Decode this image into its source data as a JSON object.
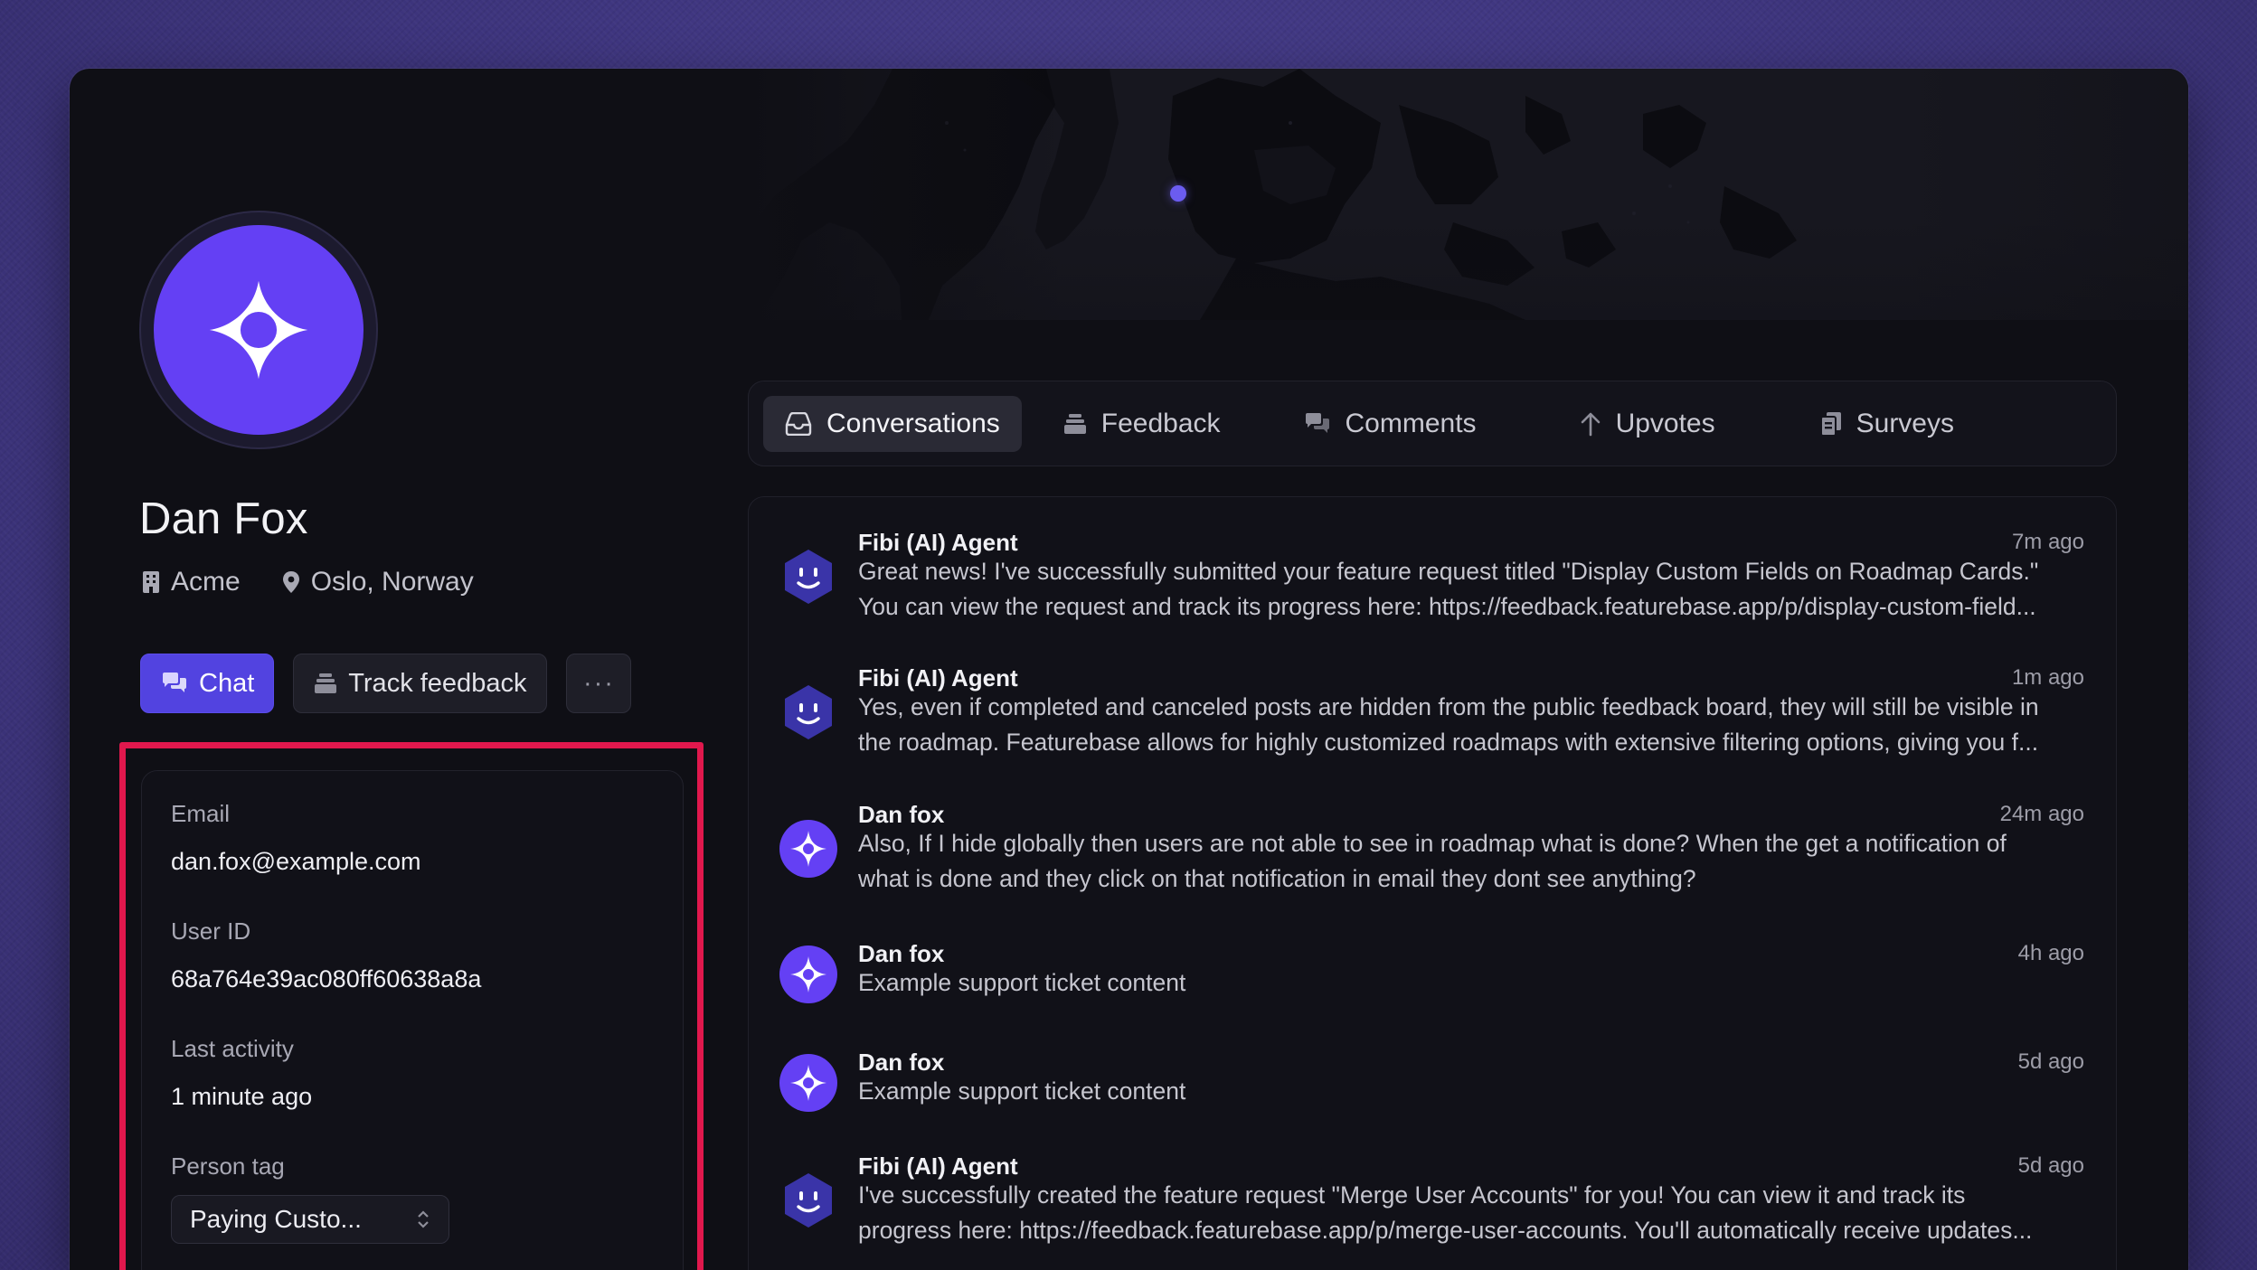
{
  "profile": {
    "name": "Dan Fox",
    "company": "Acme",
    "location": "Oslo, Norway",
    "avatar_color": "#6440f4"
  },
  "actions": {
    "chat_label": "Chat",
    "track_label": "Track feedback",
    "more_label": "···"
  },
  "details": {
    "email_label": "Email",
    "email_value": "dan.fox@example.com",
    "userid_label": "User ID",
    "userid_value": "68a764e39ac080ff60638a8a",
    "activity_label": "Last activity",
    "activity_value": "1 minute ago",
    "tag_label": "Person tag",
    "tag_value": "Paying Custo..."
  },
  "tabs": [
    {
      "label": "Conversations",
      "icon": "inbox-icon",
      "active": true
    },
    {
      "label": "Feedback",
      "icon": "stack-icon"
    },
    {
      "label": "Comments",
      "icon": "chat-bubbles-icon"
    },
    {
      "label": "Upvotes",
      "icon": "arrow-up-icon"
    },
    {
      "label": "Surveys",
      "icon": "clipboard-icon"
    }
  ],
  "conversations": [
    {
      "author": "Fibi (AI) Agent",
      "time": "7m ago",
      "line1": "Great news! I've successfully submitted your feature request titled \"Display Custom Fields on Roadmap Cards.\"",
      "line2": "You can view the request and track its progress here: https://feedback.featurebase.app/p/display-custom-field..."
    },
    {
      "author": "Fibi (AI) Agent",
      "time": "1m ago",
      "line1": "Yes, even if completed and canceled posts are hidden from the public feedback board, they will still be visible in",
      "line2": "the roadmap. Featurebase allows for highly customized roadmaps with extensive filtering options, giving you f..."
    },
    {
      "author": "Dan fox",
      "time": "24m ago",
      "line1": "Also, If I hide globally then users are not able to see in roadmap what is done? When the get a notification of",
      "line2": "what is done and they click on that notification in email they dont see anything?"
    },
    {
      "author": "Dan fox",
      "time": "4h ago",
      "line1": "Example support ticket content"
    },
    {
      "author": "Dan fox",
      "time": "5d ago",
      "line1": "Example support ticket content"
    },
    {
      "author": "Fibi (AI) Agent",
      "time": "5d ago",
      "line1": "I've successfully created the feature request \"Merge User Accounts\" for you! You can view it and track its",
      "line2": "progress here: https://feedback.featurebase.app/p/merge-user-accounts. You'll automatically receive updates..."
    }
  ],
  "colors": {
    "accent": "#5243e0",
    "highlight": "#e0184d",
    "background": "#0f0f15"
  }
}
